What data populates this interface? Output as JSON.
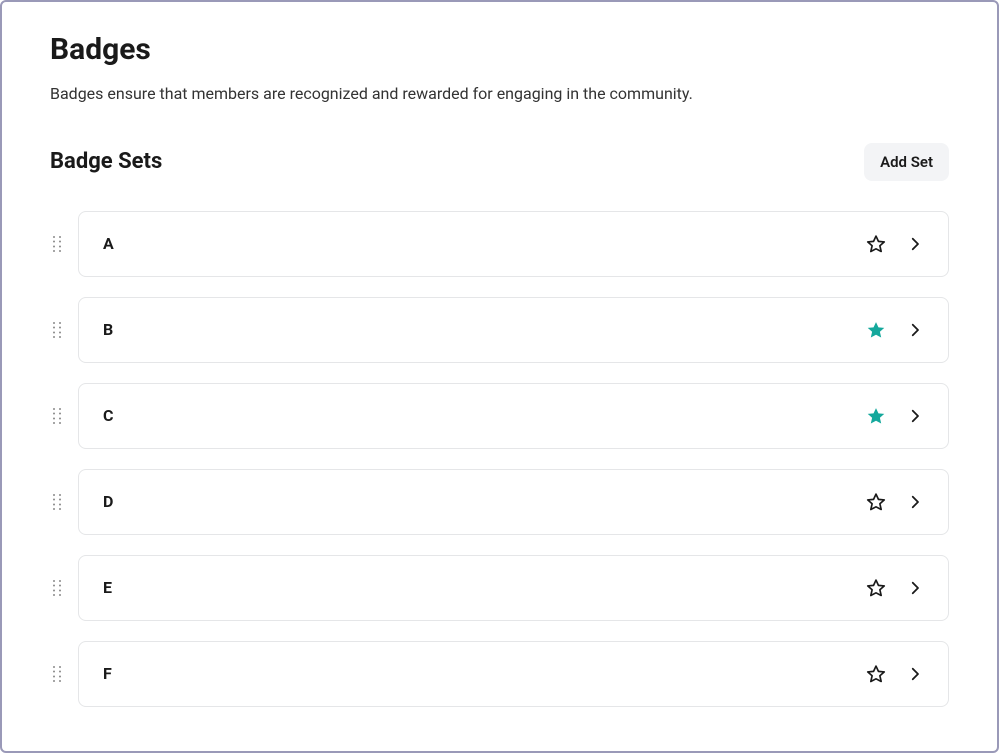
{
  "header": {
    "title": "Badges",
    "subtitle": "Badges ensure that members are recognized and rewarded for engaging in the community."
  },
  "section": {
    "title": "Badge Sets",
    "add_button_label": "Add Set"
  },
  "sets": [
    {
      "name": "A",
      "starred": false
    },
    {
      "name": "B",
      "starred": true
    },
    {
      "name": "C",
      "starred": true
    },
    {
      "name": "D",
      "starred": false
    },
    {
      "name": "E",
      "starred": false
    },
    {
      "name": "F",
      "starred": false
    }
  ],
  "colors": {
    "accent": "#14a89c",
    "border": "#e5e6e8",
    "frame_border": "#9a99b8"
  }
}
